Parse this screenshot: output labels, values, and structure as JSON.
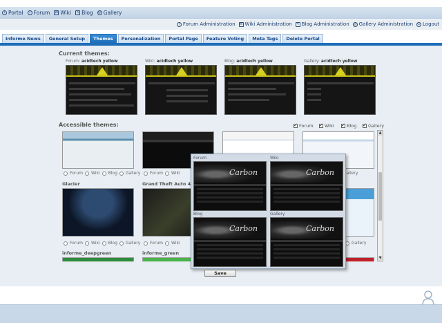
{
  "topnav": {
    "portal": "Portal",
    "forum": "Forum",
    "wiki": "Wiki",
    "blog": "Blog",
    "gallery": "Gallery"
  },
  "adminnav": {
    "forum_admin": "Forum Administration",
    "wiki_admin": "Wiki Administration",
    "blog_admin": "Blog Administration",
    "gallery_admin": "Gallery Administration",
    "logout": "Logout"
  },
  "tabs": [
    "Informe News",
    "General Setup",
    "Themes",
    "Personalization",
    "Portal Page",
    "Feature Voting",
    "Meta Tags",
    "Delete Portal"
  ],
  "active_tab": "Themes",
  "current": {
    "title": "Current themes:",
    "items": [
      {
        "prefix": "Forum:",
        "name": "acidtech yellow"
      },
      {
        "prefix": "Wiki:",
        "name": "acidtech yellow"
      },
      {
        "prefix": "Blog:",
        "name": "acidtech yellow"
      },
      {
        "prefix": "Gallery:",
        "name": "acidtech yellow"
      }
    ]
  },
  "accessible": {
    "title": "Accessible themes:",
    "filters": [
      {
        "label": "Forum",
        "checked": true
      },
      {
        "label": "Wiki",
        "checked": true
      },
      {
        "label": "Blog",
        "checked": true
      },
      {
        "label": "Gallery",
        "checked": true
      }
    ],
    "radio_labels": {
      "forum": "Forum",
      "wiki": "Wiki",
      "blog": "Blog",
      "gallery": "Gallery"
    },
    "theme_names": [
      "Glacier",
      "Grand Theft Auto 4",
      "informe_deepgreen",
      "informe_green"
    ]
  },
  "popup": {
    "labels": [
      "Forum",
      "Wiki",
      "Blog",
      "Gallery"
    ],
    "brand": "Carbon"
  },
  "save_label": "Save"
}
